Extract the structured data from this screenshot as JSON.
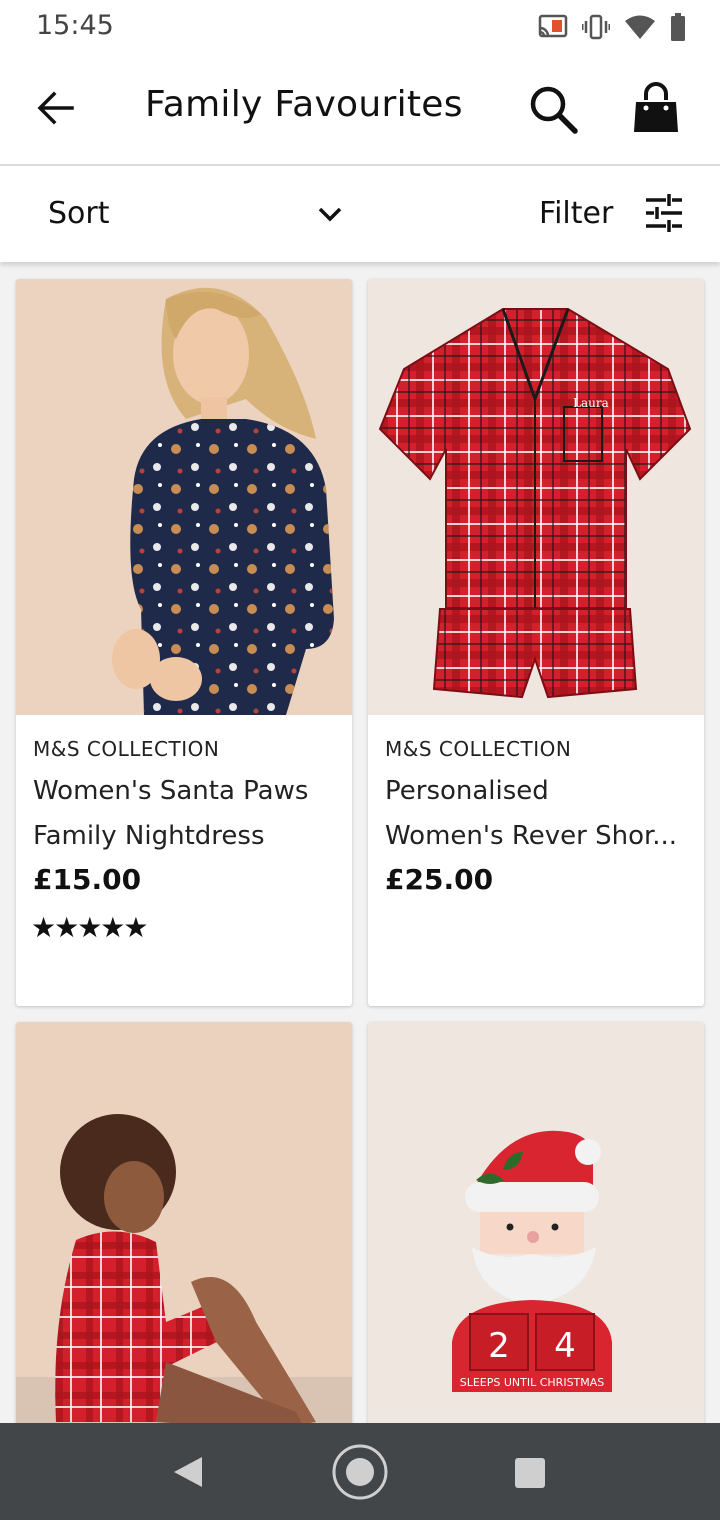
{
  "status_bar": {
    "time": "15:45",
    "icons": [
      "cast-icon",
      "vibrate-icon",
      "wifi-icon",
      "battery-icon"
    ]
  },
  "app_bar": {
    "title": "Family Favourites",
    "back_icon": "arrow-left-icon",
    "search_icon": "search-icon",
    "bag_icon": "shopping-bag-icon"
  },
  "toolbar": {
    "sort_label": "Sort",
    "filter_label": "Filter"
  },
  "products": [
    {
      "brand": "M&S COLLECTION",
      "name_line1": "Women's Santa Paws",
      "name_line2": "Family Nightdress",
      "price": "£15.00",
      "stars": "★★★★★",
      "rating": 5
    },
    {
      "brand": "M&S COLLECTION",
      "name_line1": "Personalised",
      "name_line2": "Women's Rever Shor...",
      "price": "£25.00",
      "image_text": "Laura"
    },
    {
      "brand": "",
      "name_line1": "",
      "name_line2": "",
      "price": ""
    },
    {
      "brand": "",
      "name_line1": "",
      "name_line2": "",
      "price": "",
      "image_text_digit1": "2",
      "image_text_digit2": "4",
      "image_text_caption": "SLEEPS UNTIL CHRISTMAS"
    }
  ],
  "colors": {
    "tartan_red": "#d4202c",
    "navy": "#1f2a4a",
    "navbar": "#434648"
  },
  "nav_bar": {
    "icons": [
      "back-triangle-icon",
      "home-circle-icon",
      "recents-square-icon"
    ]
  }
}
